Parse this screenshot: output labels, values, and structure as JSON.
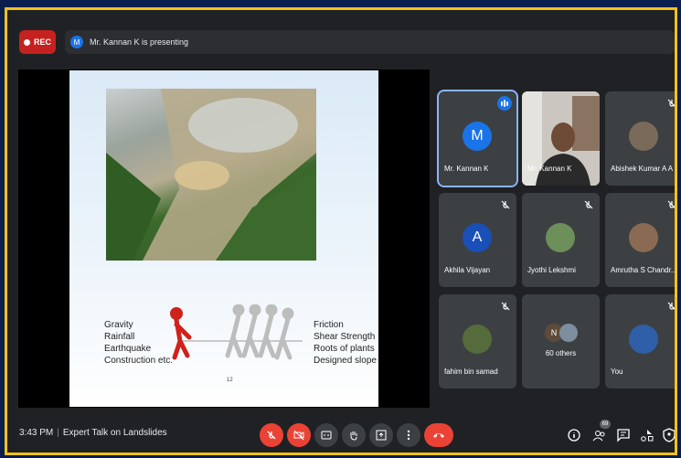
{
  "header": {
    "rec_label": "REC",
    "presenter_initial": "M",
    "presenting_text": "Mr. Kannan K is presenting"
  },
  "slide": {
    "left_items": [
      "Gravity",
      "Rainfall",
      "Earthquake",
      "Construction etc."
    ],
    "right_items": [
      "Friction",
      "Shear Strength",
      "Roots of plants",
      "Designed slope"
    ],
    "page_number": "12"
  },
  "participants": [
    {
      "name": "Mr. Kannan K",
      "initial": "M",
      "color": "#1a73e8",
      "speaking": true
    },
    {
      "name": "Mr. Kannan K",
      "kind": "video"
    },
    {
      "name": "Abishek Kumar A A",
      "kind": "photo"
    },
    {
      "name": "Akhila Vijayan",
      "initial": "A",
      "color": "#1a4fb8"
    },
    {
      "name": "Jyothi Lekshmi",
      "kind": "photo"
    },
    {
      "name": "Amrutha S Chandr...",
      "kind": "photo"
    },
    {
      "name": "fahim bin samad",
      "kind": "photo"
    },
    {
      "name": "60 others",
      "initial": "N"
    },
    {
      "name": "You",
      "kind": "photo"
    }
  ],
  "footer": {
    "time": "3:43 PM",
    "meeting_title": "Expert Talk on Landslides",
    "people_count": "69"
  },
  "colors": {
    "border": "#f2c21b",
    "outer": "#0a1f4d",
    "end_call": "#ea4335",
    "accent": "#1a73e8"
  }
}
